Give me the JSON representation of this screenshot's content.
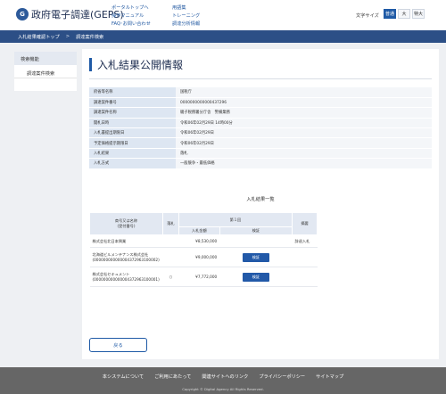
{
  "header": {
    "logo_mark": "G",
    "logo_text": "政府電子調達(GEPS)",
    "links": [
      "ポータルトップへ",
      "操作マニュアル",
      "FAQ･お問い合わせ",
      "用語集",
      "トレーニング",
      "調達分析情報"
    ],
    "font_size_label": "文字サイズ",
    "font_sizes": [
      "普通",
      "大",
      "特大"
    ],
    "active_font_size": "普通"
  },
  "breadcrumb": {
    "items": [
      "入札結果確認トップ",
      "調達案件検索"
    ],
    "separator": ">"
  },
  "sidebar": {
    "heading": "検索機能",
    "items": [
      "調達案件検索"
    ]
  },
  "main": {
    "title": "入札結果公開情報",
    "info": [
      {
        "label": "府省等名称",
        "value": "国税庁"
      },
      {
        "label": "調達案件番号",
        "value": "0000000000000437296"
      },
      {
        "label": "調達案件名称",
        "value": "磯子税務署分庁舎　警備業務"
      },
      {
        "label": "開札日時",
        "value": "令和06年02月29日 14時00分"
      },
      {
        "label": "入札書提出期限日",
        "value": "令和06年02月29日"
      },
      {
        "label": "予定価格提示期限日",
        "value": "令和06年02月29日"
      },
      {
        "label": "入札結果",
        "value": "落札"
      },
      {
        "label": "入札方式",
        "value": "一般競争・最低価格"
      }
    ],
    "results_title": "入札結果一覧",
    "results": {
      "headers": {
        "company": "商号又は名称",
        "company_sub": "(受付番号)",
        "winner": "落札",
        "round": "第１回",
        "amount": "入札金額",
        "verify": "検証",
        "note": "摘要"
      },
      "rows": [
        {
          "name": "株式会社北日本興業",
          "number": "",
          "winner": "",
          "amount": "¥8,530,000",
          "verify": "",
          "note": "辞退入札"
        },
        {
          "name": "北海道ビルメンテナンス株式会社",
          "number": "(000000000000004372963100002)",
          "winner": "",
          "amount": "¥9,000,000",
          "verify": "検証",
          "note": ""
        },
        {
          "name": "株式会社セキュメント",
          "number": "(000000000000004372963100001)",
          "winner": "○",
          "amount": "¥7,772,000",
          "verify": "検証",
          "note": ""
        }
      ]
    },
    "back_button": "戻る"
  },
  "footer": {
    "links": [
      "本システムについて",
      "ご利用にあたって",
      "関連サイトへのリンク",
      "プライバシーポリシー",
      "サイトマップ"
    ],
    "copyright": "Copyright © Digital Agency All Rights Reserved."
  }
}
